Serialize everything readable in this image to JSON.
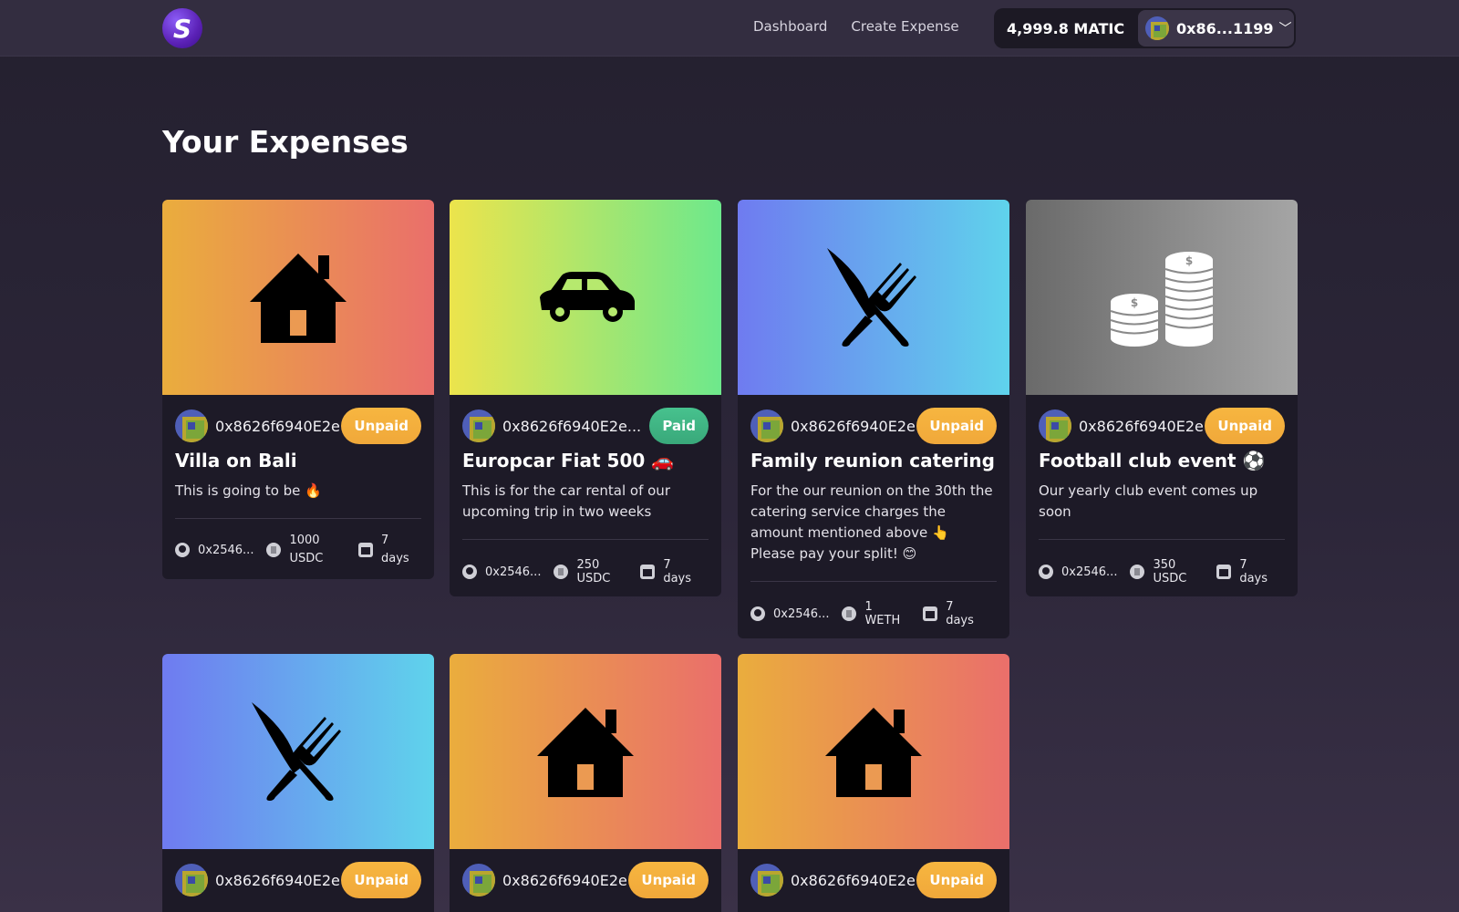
{
  "header": {
    "logo_letter": "S",
    "nav": [
      "Dashboard",
      "Create Expense"
    ],
    "balance": "4,999.8 MATIC",
    "account": "0x86...1199",
    "chevron": "﹀"
  },
  "page_title": "Your Expenses",
  "colors": {
    "background": "#2a2536",
    "card": "#1d1a27",
    "unpaid": "#f7b640",
    "paid": "#47c28e"
  },
  "expenses": [
    {
      "icon": "house-icon",
      "owner": "0x8626f6940E2e...",
      "status": "Unpaid",
      "title": "Villa on Bali",
      "description": "This is going to be 🔥",
      "payer": "0x2546...",
      "amount": "1000 USDC",
      "due": "7 days"
    },
    {
      "icon": "car-icon",
      "owner": "0x8626f6940E2e...",
      "status": "Paid",
      "title": "Europcar Fiat 500 🚗",
      "description": "This is for the car rental of our upcoming trip in two weeks",
      "payer": "0x2546...",
      "amount": "250 USDC",
      "due": "7 days"
    },
    {
      "icon": "utensils-icon",
      "owner": "0x8626f6940E2e...",
      "status": "Unpaid",
      "title": "Family reunion catering",
      "description": "For the our reunion on the 30th the catering service charges the amount mentioned above 👆 Please pay your split! 😊",
      "payer": "0x2546...",
      "amount": "1 WETH",
      "due": "7 days"
    },
    {
      "icon": "coins-icon",
      "owner": "0x8626f6940E2e...",
      "status": "Unpaid",
      "title": "Football club event ⚽",
      "description": "Our yearly club event comes up soon",
      "payer": "0x2546...",
      "amount": "350 USDC",
      "due": "7 days"
    },
    {
      "icon": "utensils-icon",
      "owner": "0x8626f6940E2e...",
      "status": "Unpaid"
    },
    {
      "icon": "house-icon",
      "owner": "0x8626f6940E2e...",
      "status": "Unpaid"
    },
    {
      "icon": "house-icon",
      "owner": "0x8626f6940E2e...",
      "status": "Unpaid"
    }
  ]
}
